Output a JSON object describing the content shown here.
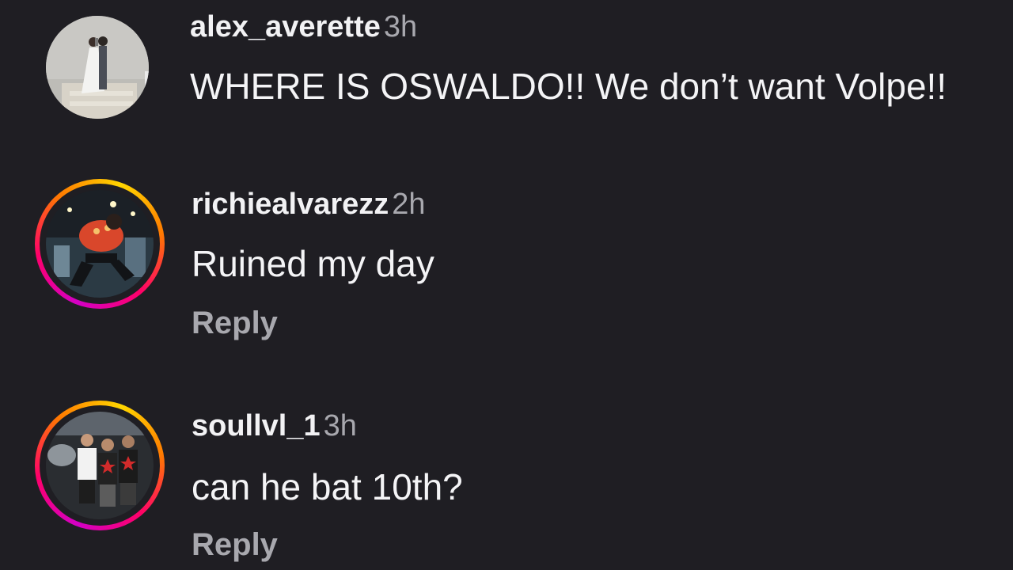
{
  "comments": [
    {
      "username": "alex_averette",
      "time": "3h",
      "text": "WHERE IS OSWALDO!! We don’t want Volpe!!",
      "has_story_ring": false
    },
    {
      "username": "richiealvarezz",
      "time": "2h",
      "text": "Ruined my day",
      "reply_label": "Reply",
      "has_story_ring": true
    },
    {
      "username": "soullvl_1",
      "time": "3h",
      "text": "can he bat 10th?",
      "reply_label": "Reply",
      "has_story_ring": true
    }
  ],
  "colors": {
    "background": "#1f1e23",
    "text_primary": "#f4f4f6",
    "text_secondary": "#a8a8ae",
    "story_ring": [
      "#d300c5",
      "#ff0069",
      "#ff7a00",
      "#ffd600"
    ]
  }
}
